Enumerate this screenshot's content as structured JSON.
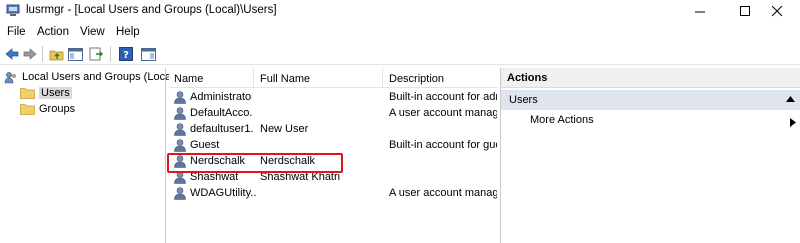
{
  "window": {
    "title": "lusrmgr - [Local Users and Groups (Local)\\Users]"
  },
  "menu": [
    "File",
    "Action",
    "View",
    "Help"
  ],
  "toolbar": {
    "icons": [
      "back-arrow-icon",
      "forward-arrow-icon",
      "up-folder-icon",
      "show-tree-icon",
      "export-list-icon",
      "help-icon",
      "action-pane-icon"
    ]
  },
  "tree": {
    "root": "Local Users and Groups (Local)",
    "children": [
      {
        "label": "Users",
        "selected": true
      },
      {
        "label": "Groups",
        "selected": false
      }
    ]
  },
  "list": {
    "columns": [
      "Name",
      "Full Name",
      "Description"
    ],
    "rows": [
      {
        "name": "Administrator",
        "full_name": "",
        "description": "Built-in account for adn"
      },
      {
        "name": "DefaultAcco...",
        "full_name": "",
        "description": "A user account manage"
      },
      {
        "name": "defaultuser1...",
        "full_name": "New User",
        "description": ""
      },
      {
        "name": "Guest",
        "full_name": "",
        "description": "Built-in account for gue"
      },
      {
        "name": "Nerdschalk",
        "full_name": "Nerdschalk",
        "description": ""
      },
      {
        "name": "Shashwat",
        "full_name": "Shashwat Khatri",
        "description": ""
      },
      {
        "name": "WDAGUtility...",
        "full_name": "",
        "description": "A user account manage"
      }
    ],
    "highlighted_row": "Nerdschalk",
    "highlight_color": "#e0141e"
  },
  "actions": {
    "header": "Actions",
    "section": "Users",
    "items": [
      "More Actions"
    ]
  }
}
